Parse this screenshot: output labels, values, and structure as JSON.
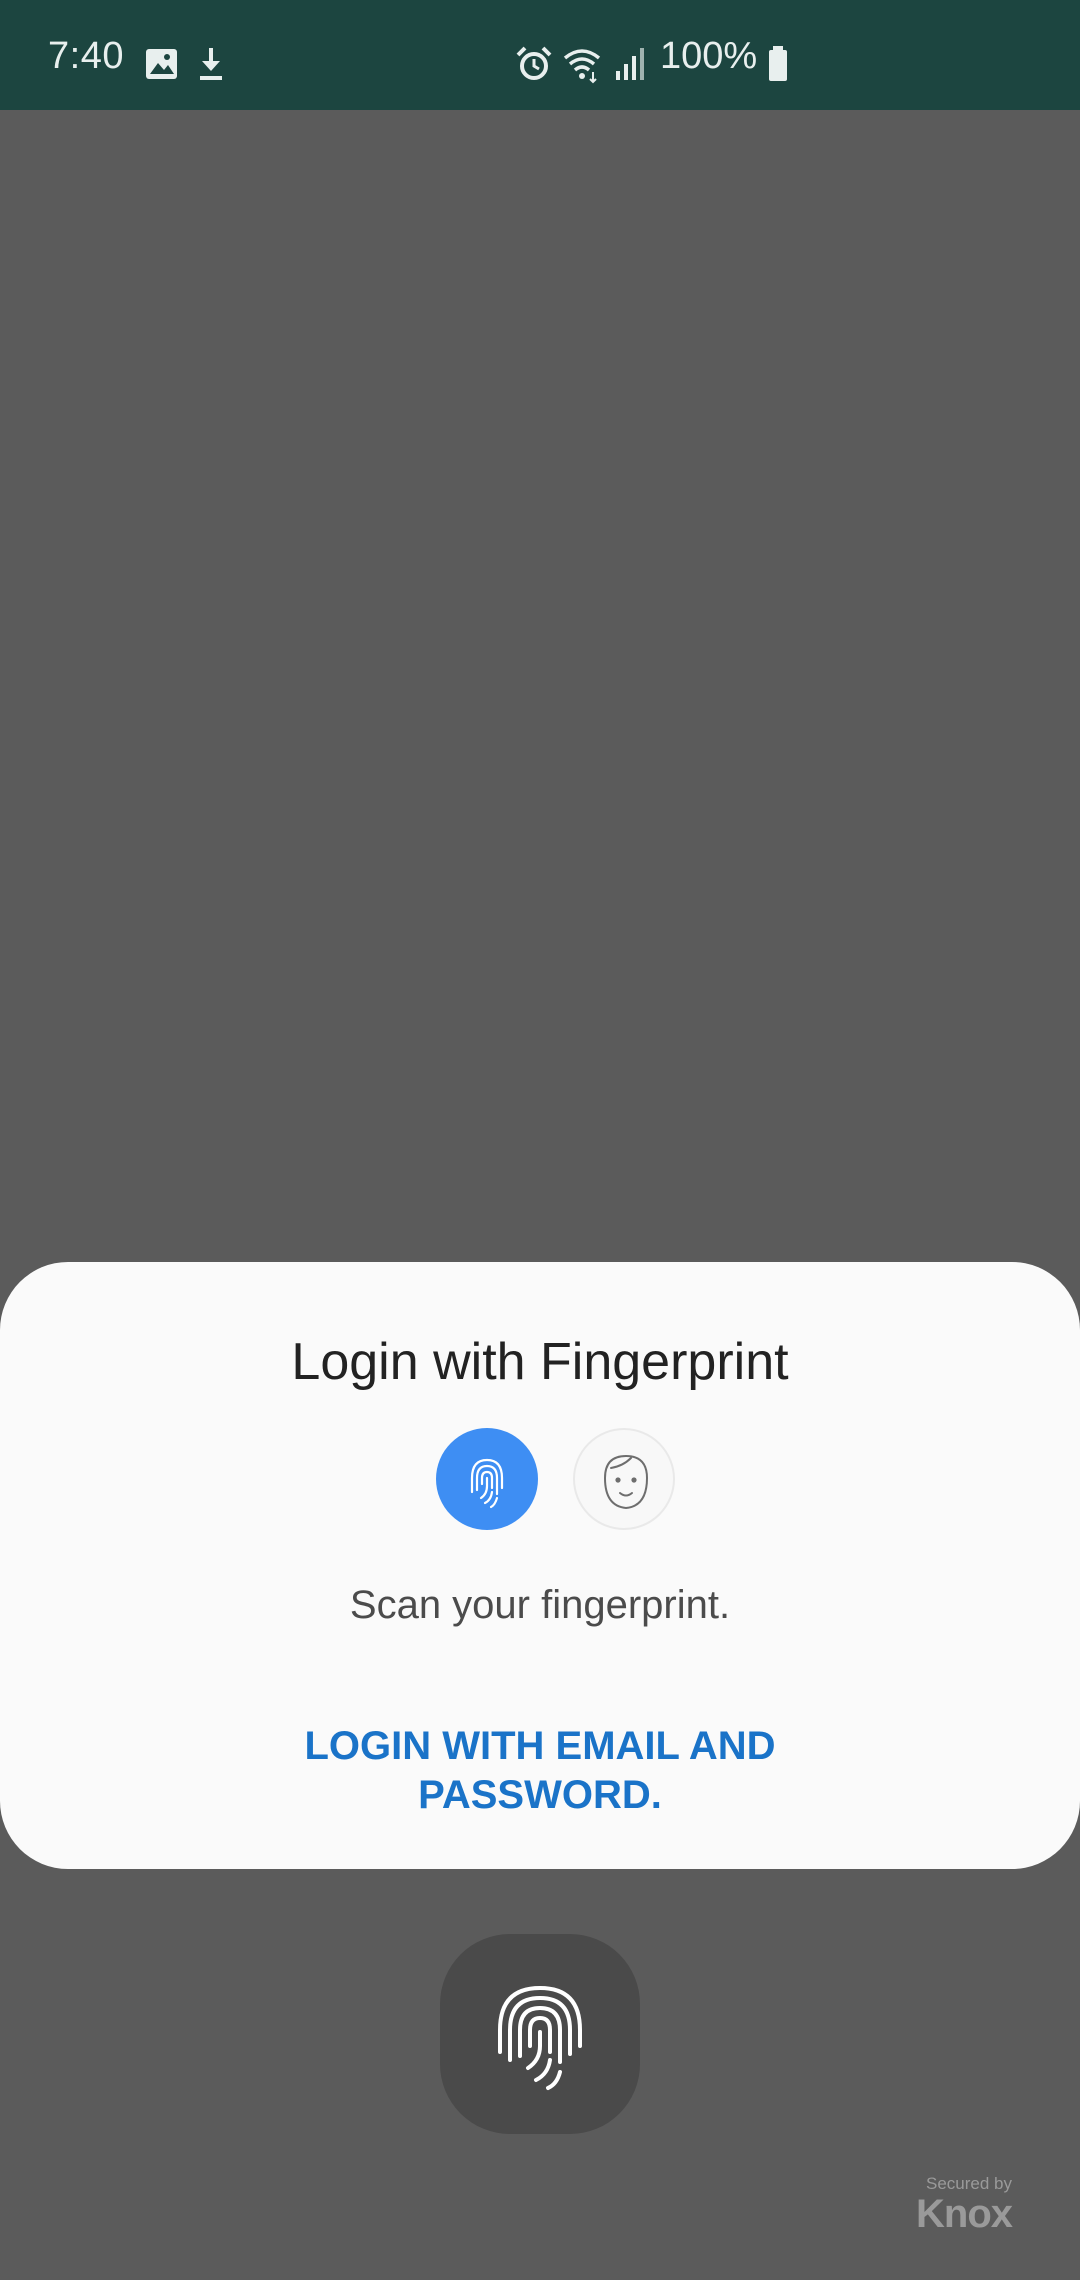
{
  "status_bar": {
    "time": "7:40",
    "battery_text": "100%",
    "icons": [
      "image-icon",
      "download-icon",
      "alarm-icon",
      "wifi-icon",
      "signal-icon",
      "battery-icon"
    ]
  },
  "dialog": {
    "title": "Login with Fingerprint",
    "auth_options": [
      "fingerprint-icon",
      "face-icon"
    ],
    "selected_option": "fingerprint-icon",
    "instruction": "Scan your fingerprint.",
    "alt_login_line1": "LOGIN WITH EMAIL AND",
    "alt_login_line2": "PASSWORD."
  },
  "footer": {
    "secured_by": "Secured by",
    "brand": "Knox"
  },
  "colors": {
    "status_bar": "#1c4540",
    "scrim": "#5b5b5b",
    "sheet": "#fafafa",
    "accent": "#3e8ef3",
    "link": "#1a73c8"
  }
}
